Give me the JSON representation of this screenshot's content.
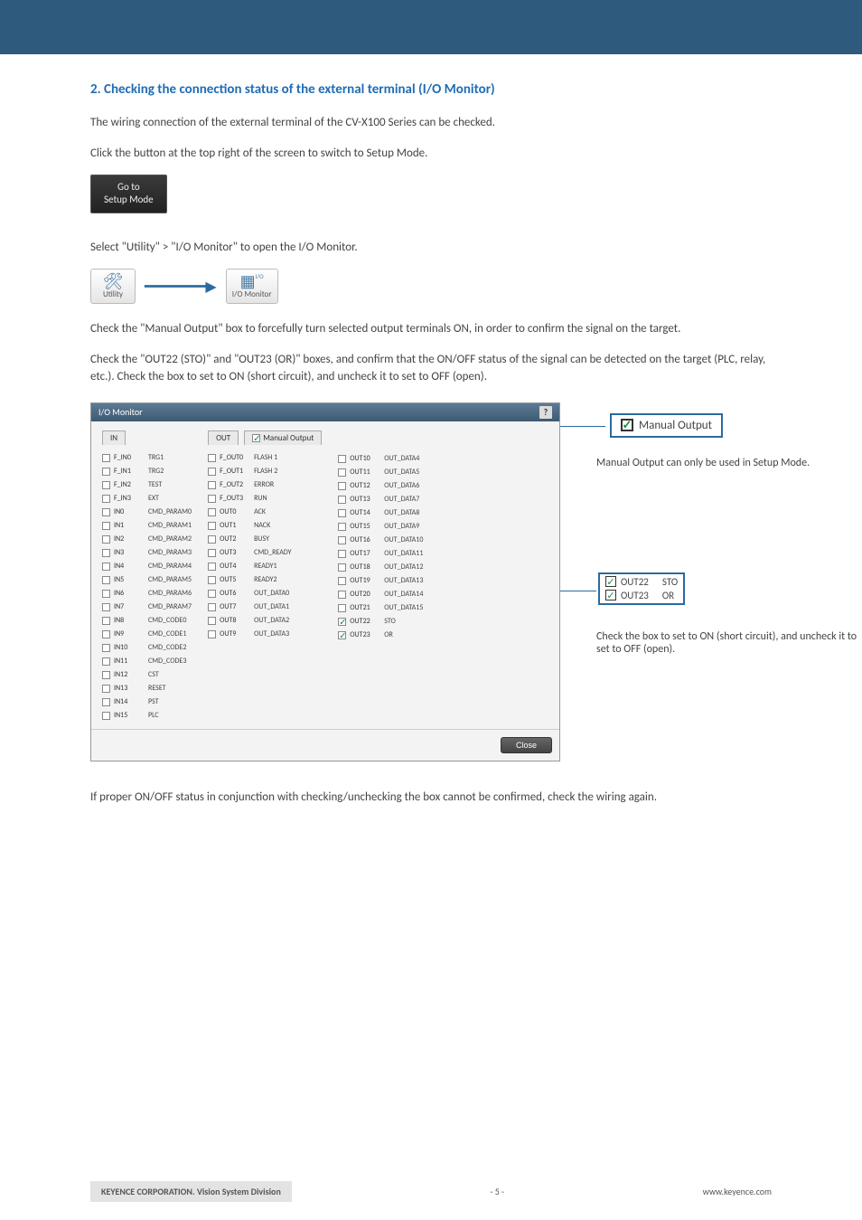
{
  "heading": "2. Checking the connection status of the external terminal (I/O Monitor)",
  "p1": "The wiring connection of the external terminal of the CV-X100 Series can be checked.",
  "p2": "Click the button at the top right of the screen to switch to Setup Mode.",
  "setup_btn_l1": "Go to",
  "setup_btn_l2": "Setup Mode",
  "p3": "Select \"Utility\" > \"I/O Monitor\" to open the I/O Monitor.",
  "icon_utility": "Utility",
  "icon_iomon_t": "I/O",
  "icon_iomon": "I/O Monitor",
  "p4a": "Check the \"Manual Output\" box to forcefully turn selected output terminals ON, in order to confirm the signal on the target.",
  "p4b": "Check the \"OUT22 (STO)\" and \"OUT23 (OR)\" boxes, and confirm that the ON/OFF status of the signal can be detected on the target (PLC, relay, etc.). Check the box to set to ON (short circuit), and uncheck it to set to OFF (open).",
  "io_title": "I/O Monitor",
  "tab_in": "IN",
  "tab_out": "OUT",
  "tab_mo": "Manual Output",
  "close": "Close",
  "annot1": "Manual Output can only be used in Setup Mode.",
  "annot2": "Check the box to set to ON (short circuit), and uncheck it to set to OFF (open).",
  "callout1": "Manual Output",
  "co_out22": "OUT22",
  "co_sto": "STO",
  "co_out23": "OUT23",
  "co_or": "OR",
  "p5": "If proper ON/OFF status in conjunction with checking/unchecking the box cannot be confirmed, check the wiring again.",
  "in": [
    {
      "n": "F_IN0",
      "l": "TRG1"
    },
    {
      "n": "F_IN1",
      "l": "TRG2"
    },
    {
      "n": "F_IN2",
      "l": "TEST"
    },
    {
      "n": "F_IN3",
      "l": "EXT"
    },
    {
      "n": "IN0",
      "l": "CMD_PARAM0"
    },
    {
      "n": "IN1",
      "l": "CMD_PARAM1"
    },
    {
      "n": "IN2",
      "l": "CMD_PARAM2"
    },
    {
      "n": "IN3",
      "l": "CMD_PARAM3"
    },
    {
      "n": "IN4",
      "l": "CMD_PARAM4"
    },
    {
      "n": "IN5",
      "l": "CMD_PARAM5"
    },
    {
      "n": "IN6",
      "l": "CMD_PARAM6"
    },
    {
      "n": "IN7",
      "l": "CMD_PARAM7"
    },
    {
      "n": "IN8",
      "l": "CMD_CODE0"
    },
    {
      "n": "IN9",
      "l": "CMD_CODE1"
    },
    {
      "n": "IN10",
      "l": "CMD_CODE2"
    },
    {
      "n": "IN11",
      "l": "CMD_CODE3"
    },
    {
      "n": "IN12",
      "l": "CST"
    },
    {
      "n": "IN13",
      "l": "RESET"
    },
    {
      "n": "IN14",
      "l": "PST"
    },
    {
      "n": "IN15",
      "l": "PLC"
    }
  ],
  "out1": [
    {
      "n": "F_OUT0",
      "l": "FLASH 1"
    },
    {
      "n": "F_OUT1",
      "l": "FLASH 2"
    },
    {
      "n": "F_OUT2",
      "l": "ERROR"
    },
    {
      "n": "F_OUT3",
      "l": "RUN"
    },
    {
      "n": "OUT0",
      "l": "ACK"
    },
    {
      "n": "OUT1",
      "l": "NACK"
    },
    {
      "n": "OUT2",
      "l": "BUSY"
    },
    {
      "n": "OUT3",
      "l": "CMD_READY"
    },
    {
      "n": "OUT4",
      "l": "READY1"
    },
    {
      "n": "OUT5",
      "l": "READY2"
    },
    {
      "n": "OUT6",
      "l": "OUT_DATA0"
    },
    {
      "n": "OUT7",
      "l": "OUT_DATA1"
    },
    {
      "n": "OUT8",
      "l": "OUT_DATA2"
    },
    {
      "n": "OUT9",
      "l": "OUT_DATA3"
    }
  ],
  "out2": [
    {
      "n": "OUT10",
      "l": "OUT_DATA4"
    },
    {
      "n": "OUT11",
      "l": "OUT_DATA5"
    },
    {
      "n": "OUT12",
      "l": "OUT_DATA6"
    },
    {
      "n": "OUT13",
      "l": "OUT_DATA7"
    },
    {
      "n": "OUT14",
      "l": "OUT_DATA8"
    },
    {
      "n": "OUT15",
      "l": "OUT_DATA9"
    },
    {
      "n": "OUT16",
      "l": "OUT_DATA10"
    },
    {
      "n": "OUT17",
      "l": "OUT_DATA11"
    },
    {
      "n": "OUT18",
      "l": "OUT_DATA12"
    },
    {
      "n": "OUT19",
      "l": "OUT_DATA13"
    },
    {
      "n": "OUT20",
      "l": "OUT_DATA14"
    },
    {
      "n": "OUT21",
      "l": "OUT_DATA15"
    },
    {
      "n": "OUT22",
      "l": "STO",
      "on": true
    },
    {
      "n": "OUT23",
      "l": "OR",
      "on": true
    }
  ],
  "footer_l": "KEYENCE CORPORATION. Vision System Division",
  "footer_c": "- 5 -",
  "footer_r": "www.keyence.com"
}
